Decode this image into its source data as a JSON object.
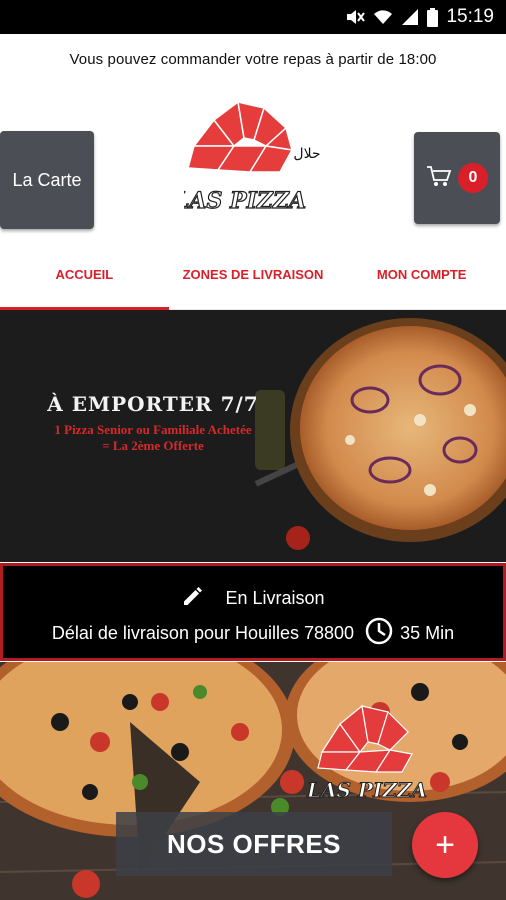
{
  "status": {
    "time": "15:19"
  },
  "notice": "Vous pouvez commander votre repas à partir de 18:00",
  "header": {
    "menu_label": "La Carte",
    "cart_count": "0",
    "logo_text": "LAS PIZZA",
    "logo_arabic": "حلال"
  },
  "tabs": [
    {
      "label": "ACCUEIL",
      "active": true
    },
    {
      "label": "ZONES DE LIVRAISON",
      "active": false
    },
    {
      "label": "MON COMPTE",
      "active": false
    }
  ],
  "banner": {
    "title": "À EMPORTER 7/7",
    "line1": "1 Pizza Senior ou Familiale Achetée",
    "line2": "= La 2ème Offerte"
  },
  "delivery": {
    "mode": "En Livraison",
    "label": "Délai de livraison pour Houilles 78800",
    "time": "35 Min"
  },
  "offers": {
    "button_label": "NOS OFFRES",
    "logo_text": "LAS PIZZA",
    "fab_label": "+"
  },
  "colors": {
    "accent": "#d9202a",
    "dark_button": "#4b4f55"
  }
}
